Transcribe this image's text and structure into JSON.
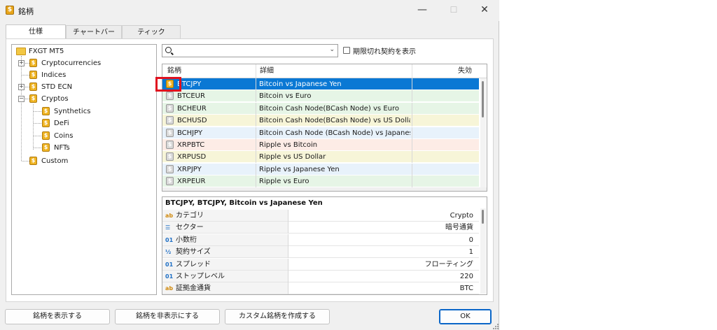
{
  "window": {
    "title": "銘柄",
    "minimize": "—",
    "maximize": "☐",
    "close": "✕"
  },
  "tabs": [
    {
      "label": "仕様",
      "active": true
    },
    {
      "label": "チャートバー",
      "active": false
    },
    {
      "label": "ティック",
      "active": false
    }
  ],
  "tree": {
    "root": "FXGT MT5",
    "items": [
      {
        "label": "Cryptocurrencies",
        "expander": "+"
      },
      {
        "label": "Indices",
        "expander": ""
      },
      {
        "label": "STD ECN",
        "expander": "+"
      },
      {
        "label": "Cryptos",
        "expander": "−"
      },
      {
        "label": "Synthetics",
        "expander": ""
      },
      {
        "label": "DeFi",
        "expander": ""
      },
      {
        "label": "Coins",
        "expander": ""
      },
      {
        "label": "NFTs",
        "expander": ""
      },
      {
        "label": "Custom",
        "expander": ""
      }
    ]
  },
  "search": {
    "value": "",
    "icon": "search-icon",
    "dropdown_icon": "chevron-down-icon"
  },
  "expired_checkbox": {
    "label": "期限切れ契約を表示",
    "checked": false
  },
  "symbols_table": {
    "headers": [
      "銘柄",
      "詳細",
      "失効"
    ],
    "rows": [
      {
        "symbol": "BTCJPY",
        "description": "Bitcoin vs Japanese Yen",
        "expiry": "",
        "color": "#0a78d4",
        "selected": true
      },
      {
        "symbol": "BTCEUR",
        "description": "Bitcoin vs Euro",
        "expiry": "",
        "color": "#e6f5e6",
        "selected": false
      },
      {
        "symbol": "BCHEUR",
        "description": "Bitcoin Cash Node(BCash Node) vs Euro",
        "expiry": "",
        "color": "#e6f5e6",
        "selected": false
      },
      {
        "symbol": "BCHUSD",
        "description": "Bitcoin Cash Node(BCash Node) vs US Dollar",
        "expiry": "",
        "color": "#f7f5d8",
        "selected": false
      },
      {
        "symbol": "BCHJPY",
        "description": "Bitcoin Cash Node (BCash Node) vs Japanese ...",
        "expiry": "",
        "color": "#e8f2fb",
        "selected": false
      },
      {
        "symbol": "XRPBTC",
        "description": "Ripple vs Bitcoin",
        "expiry": "",
        "color": "#fdece6",
        "selected": false
      },
      {
        "symbol": "XRPUSD",
        "description": "Ripple vs US Dollar",
        "expiry": "",
        "color": "#f7f5d8",
        "selected": false
      },
      {
        "symbol": "XRPJPY",
        "description": "Ripple vs Japanese Yen",
        "expiry": "",
        "color": "#e8f2fb",
        "selected": false
      },
      {
        "symbol": "XRPEUR",
        "description": "Ripple vs Euro",
        "expiry": "",
        "color": "#e6f5e6",
        "selected": false
      }
    ]
  },
  "properties": {
    "title": "BTCJPY, BTCJPY, Bitcoin vs Japanese Yen",
    "rows": [
      {
        "icon": "ab",
        "label": "カテゴリ",
        "value": "Crypto"
      },
      {
        "icon": "☰",
        "label": "セクター",
        "value": "暗号通貨"
      },
      {
        "icon": "01",
        "label": "小数桁",
        "value": "0"
      },
      {
        "icon": "½",
        "label": "契約サイズ",
        "value": "1"
      },
      {
        "icon": "01",
        "label": "スプレッド",
        "value": "フローティング"
      },
      {
        "icon": "01",
        "label": "ストップレベル",
        "value": "220"
      },
      {
        "icon": "ab",
        "label": "証拠金通貨",
        "value": "BTC"
      }
    ]
  },
  "buttons": {
    "show": "銘柄を表示する",
    "hide": "銘柄を非表示にする",
    "create_custom": "カスタム銘柄を作成する",
    "ok": "OK"
  },
  "colors": {
    "selection": "#0a78d4",
    "highlight_box": "#e0121f",
    "coin_icon": "#efb423"
  }
}
